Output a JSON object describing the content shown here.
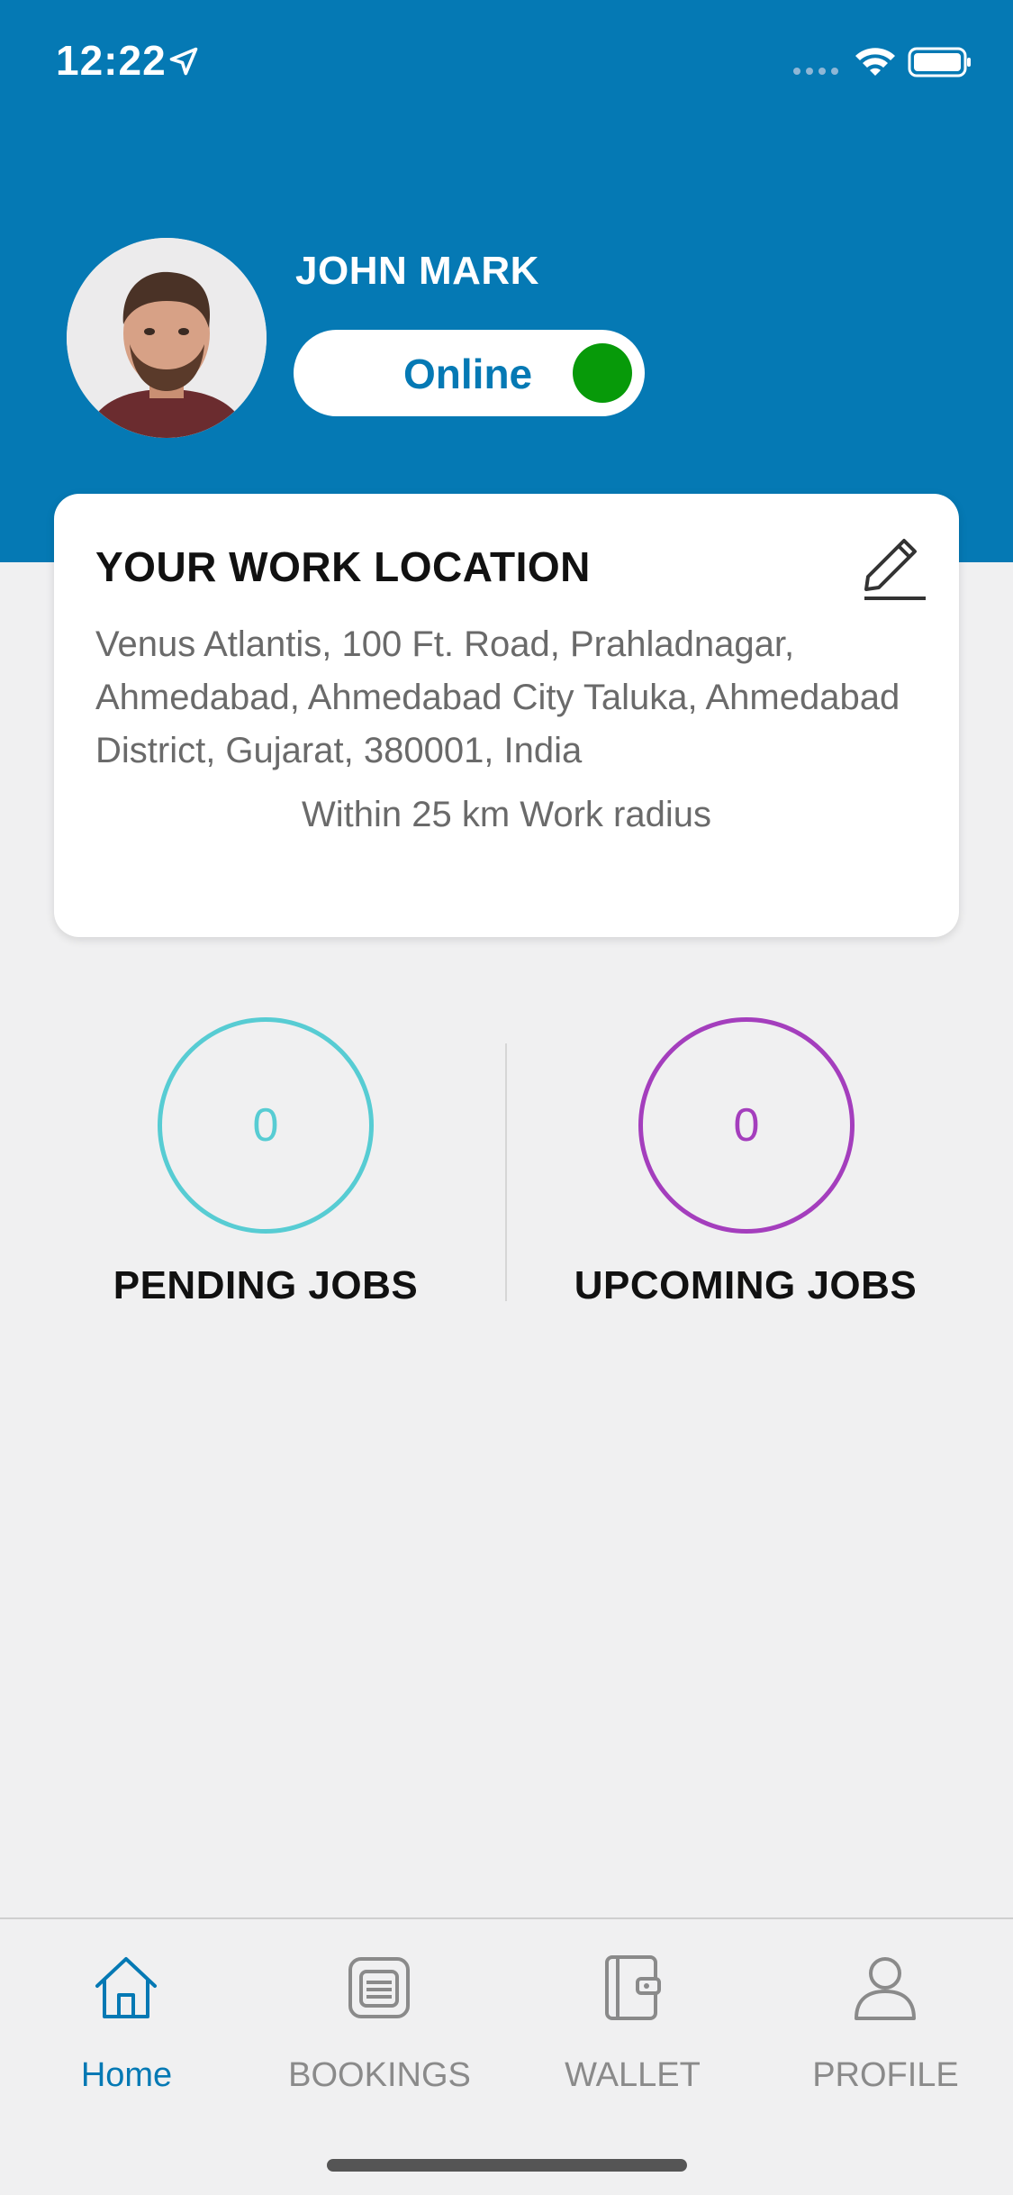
{
  "status_bar": {
    "time": "12:22",
    "icons": [
      "location-arrow-icon",
      "signal-icon",
      "wifi-icon",
      "battery-icon"
    ]
  },
  "profile": {
    "name": "JOHN MARK",
    "status": "Online",
    "status_color": "#079a09"
  },
  "work_location": {
    "title": "YOUR WORK LOCATION",
    "address": "Venus Atlantis, 100 Ft. Road, Prahladnagar, Ahmedabad, Ahmedabad City Taluka, Ahmedabad District, Gujarat, 380001, India",
    "radius_text": "Within 25 km Work radius",
    "edit_icon": "pencil-icon"
  },
  "stats": {
    "pending": {
      "count": "0",
      "label": "PENDING JOBS",
      "color": "#57ccd3"
    },
    "upcoming": {
      "count": "0",
      "label": "UPCOMING JOBS",
      "color": "#a43ebd"
    }
  },
  "tabs": [
    {
      "label": "Home",
      "icon": "home-icon",
      "active": true
    },
    {
      "label": "BOOKINGS",
      "icon": "bookings-icon",
      "active": false
    },
    {
      "label": "WALLET",
      "icon": "wallet-icon",
      "active": false
    },
    {
      "label": "PROFILE",
      "icon": "person-icon",
      "active": false
    }
  ],
  "colors": {
    "primary": "#0579b4",
    "background": "#f0f0f1"
  }
}
